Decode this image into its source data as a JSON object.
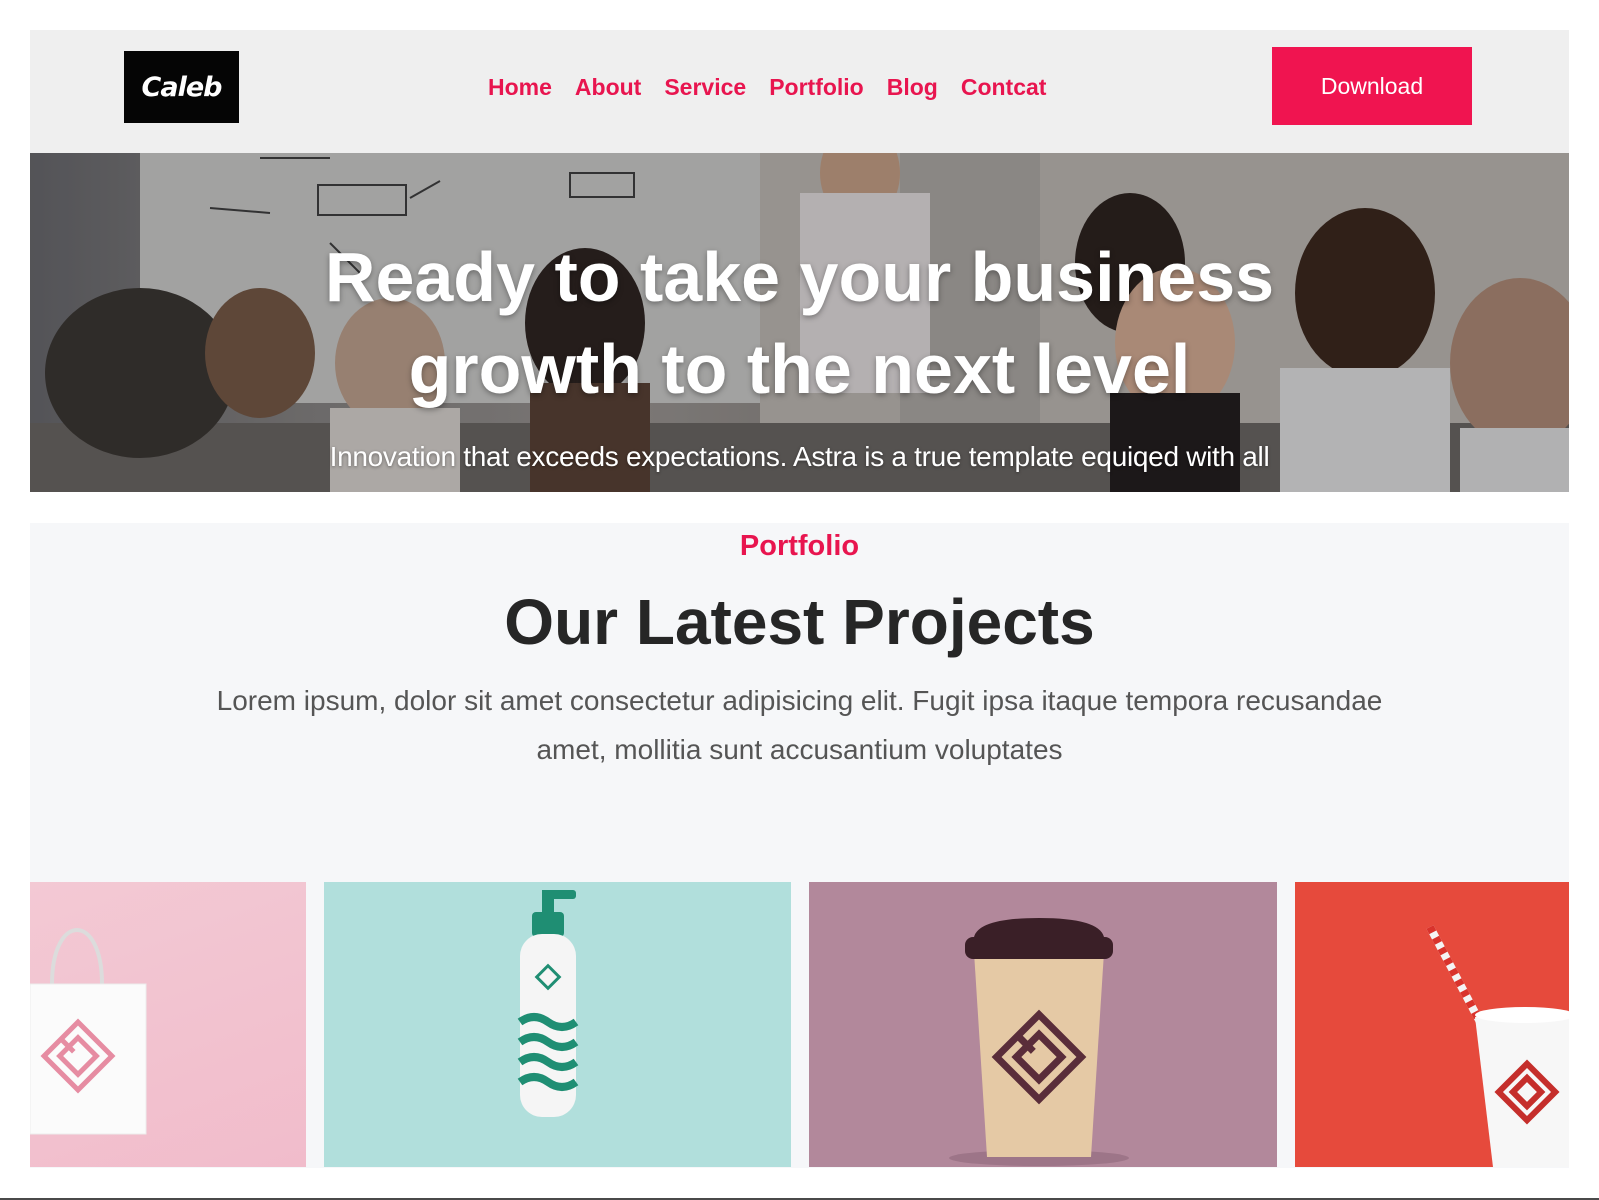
{
  "brand": {
    "logo_text": "Caleb"
  },
  "nav": {
    "items": [
      {
        "label": "Home"
      },
      {
        "label": "About"
      },
      {
        "label": "Service"
      },
      {
        "label": "Portfolio"
      },
      {
        "label": "Blog"
      },
      {
        "label": "Contcat"
      }
    ],
    "cta_label": "Download"
  },
  "hero": {
    "title_line1": "Ready to take your business",
    "title_line2": "growth to the next level",
    "subtitle": "Innovation that exceeds expectations. Astra is a true template equiqed with all"
  },
  "portfolio": {
    "eyebrow": "Portfolio",
    "title": "Our Latest Projects",
    "description": "Lorem ipsum, dolor sit amet consectetur adipisicing elit. Fugit ipsa itaque tempora recusandae amet, mollitia sunt accusantium voluptates",
    "projects": [
      {
        "image": "shopping-bag-mockup",
        "background": "#f3c9d4"
      },
      {
        "image": "bottle-mockup",
        "background": "#b1dfdc"
      },
      {
        "image": "coffee-cup-mockup",
        "background": "#b2889b"
      },
      {
        "image": "drink-cup-mockup",
        "background": "#e64a3c"
      }
    ]
  },
  "colors": {
    "accent": "#e8154f",
    "button": "#f01450",
    "header_bg": "#efefef",
    "section_bg": "#f6f7f9"
  }
}
